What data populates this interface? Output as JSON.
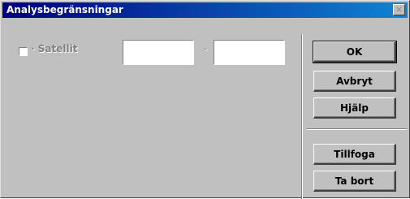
{
  "window": {
    "title": "Analysbegränsningar",
    "close_glyph": "×"
  },
  "filter": {
    "checkbox_label": "· Satellit",
    "checked": false,
    "range_separator": "-",
    "from_value": "",
    "to_value": ""
  },
  "buttons": {
    "ok": "OK",
    "cancel": "Avbryt",
    "help": "Hjälp",
    "add": "Tillfoga",
    "remove": "Ta bort"
  }
}
